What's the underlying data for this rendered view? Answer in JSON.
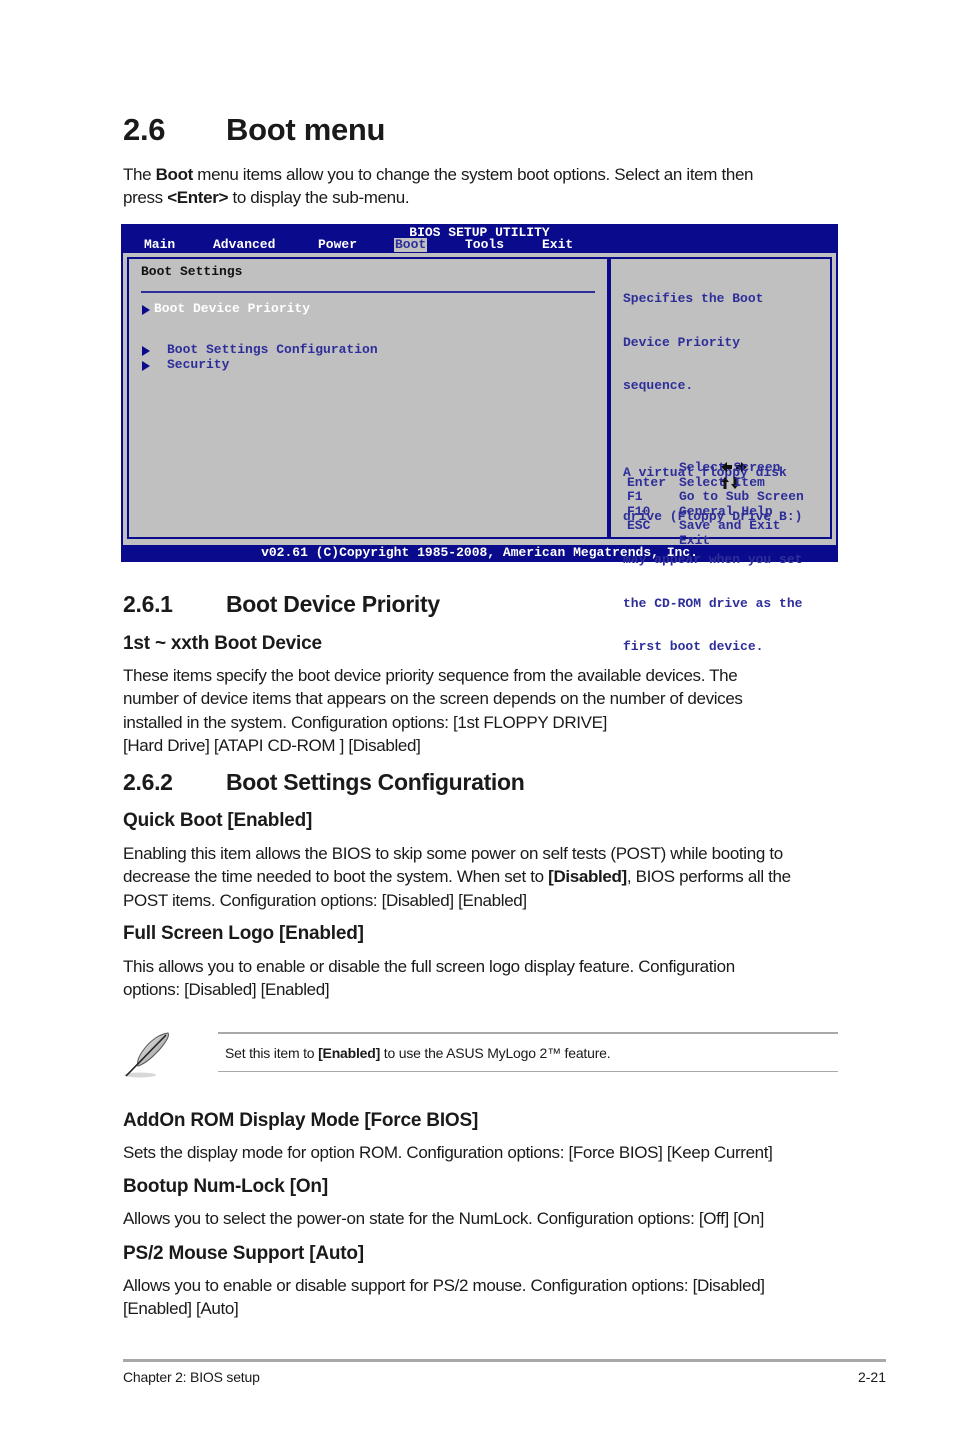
{
  "section": {
    "number": "2.6",
    "title": "Boot menu",
    "intro": {
      "part1": "The ",
      "bold1": "Boot",
      "part2": " menu items allow you to change the system boot options. Select an item then",
      "part3": "press ",
      "bold2": "<Enter>",
      "part4": " to display the sub-menu."
    }
  },
  "bios": {
    "title": "BIOS SETUP UTILITY",
    "tabs": [
      {
        "label": "Main"
      },
      {
        "label": "Advanced"
      },
      {
        "label": "Power"
      },
      {
        "label": "Boot",
        "active": true
      },
      {
        "label": "Tools"
      },
      {
        "label": "Exit"
      }
    ],
    "panel_heading": "Boot Settings",
    "items": [
      {
        "label": "Boot Device Priority",
        "selected": true
      },
      {
        "label": "Boot Settings Configuration"
      },
      {
        "label": "Security"
      }
    ],
    "help_text": [
      "Specifies the Boot",
      "Device Priority",
      "sequence.",
      "",
      "A virtual floppy disk",
      "drive (Floppy Drive B:)",
      "may appear when you set",
      "the CD-ROM drive as the",
      "first boot device."
    ],
    "keys": [
      {
        "key": "left-right-arrows-icon",
        "desc": "Select Screen"
      },
      {
        "key": "up-down-arrows-icon",
        "desc": "Select Item"
      },
      {
        "key": "Enter",
        "desc": "Go to Sub Screen"
      },
      {
        "key": "F1",
        "desc": "General Help"
      },
      {
        "key": "F10",
        "desc": "Save and Exit"
      },
      {
        "key": "ESC",
        "desc": "Exit"
      }
    ],
    "footer": "v02.61 (C)Copyright 1985-2008, American Megatrends, Inc."
  },
  "subsections": [
    {
      "number": "2.6.1",
      "title": "Boot Device Priority"
    },
    {
      "number": "2.6.2",
      "title": "Boot Settings Configuration"
    }
  ],
  "boot_device": {
    "heading": "1st ~ xxth Boot Device",
    "lines": [
      "These items specify the boot device priority sequence from the available devices. The",
      "number of device items that appears on the screen depends on the number of devices",
      "installed in the system. Configuration options: [1st FLOPPY DRIVE]",
      "[Hard Drive] [ATAPI CD-ROM ] [Disabled]"
    ]
  },
  "quick_boot": {
    "heading": "Quick Boot [Enabled]",
    "line1": "Enabling this item allows the BIOS to skip some power on self tests (POST) while booting to",
    "line2a": "decrease the time needed to boot the system. When set to ",
    "line2b": "[Disabled]",
    "line2c": ", BIOS performs all the",
    "line3": "POST items. Configuration options: [Disabled] [Enabled]"
  },
  "full_screen_logo": {
    "heading": "Full Screen Logo [Enabled]",
    "lines": [
      "This allows you to enable or disable the full screen logo display feature. Configuration",
      "options: [Disabled] [Enabled]"
    ]
  },
  "note": {
    "icon": "feather-pen-icon",
    "part1": "Set this item to ",
    "bold": "[Enabled]",
    "part2": " to use the ASUS MyLogo 2™ feature."
  },
  "addon_rom": {
    "heading": "AddOn ROM Display Mode [Force BIOS]",
    "text": "Sets the display mode for option ROM. Configuration options: [Force BIOS] [Keep Current]"
  },
  "numlock": {
    "heading": "Bootup Num-Lock [On]",
    "text": "Allows you to select the power-on state for the NumLock. Configuration options: [Off] [On]"
  },
  "ps2_mouse": {
    "heading": "PS/2 Mouse Support [Auto]",
    "lines": [
      "Allows you to enable or disable support for PS/2 mouse. Configuration options: [Disabled]",
      "[Enabled] [Auto]"
    ]
  },
  "footer": {
    "chapter": "Chapter 2: BIOS setup",
    "page": "2-21"
  }
}
